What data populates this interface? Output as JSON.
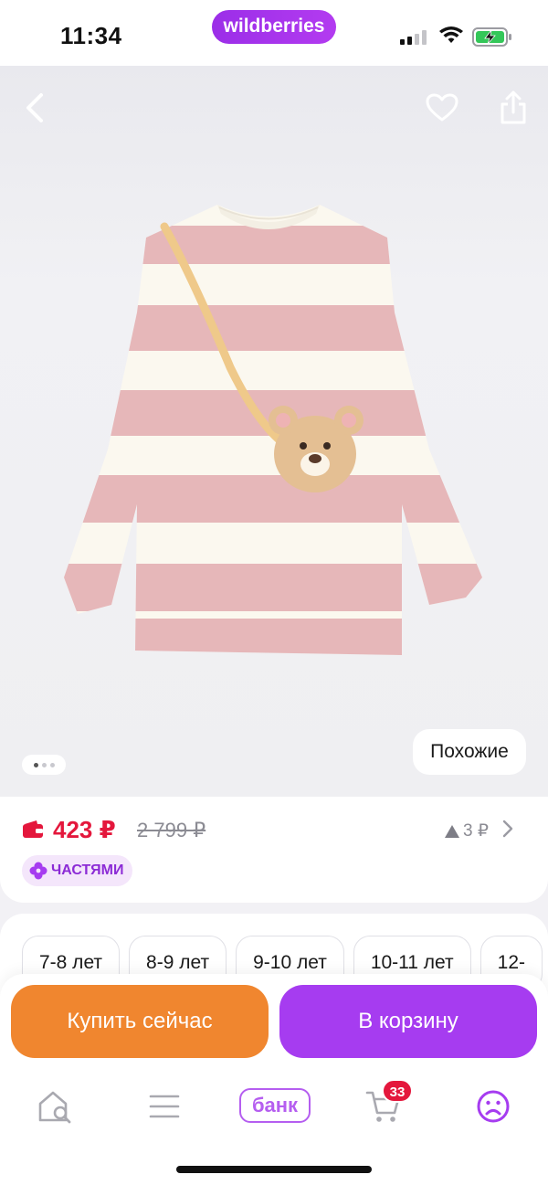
{
  "status_bar": {
    "time": "11:34",
    "brand": "wildberries"
  },
  "hero": {
    "back_icon": "chevron-left-icon",
    "favorite_icon": "heart-icon",
    "share_icon": "share-icon",
    "similar_label": "Похожие",
    "image_count": 3,
    "active_image": 1
  },
  "price": {
    "current": "423 ₽",
    "old": "2 799 ₽",
    "delta": "3 ₽",
    "installments_label": "ЧАСТЯМИ"
  },
  "sizes": [
    "7-8 лет",
    "8-9 лет",
    "9-10 лет",
    "10-11 лет",
    "12-"
  ],
  "actions": {
    "buy_now": "Купить сейчас",
    "add_to_cart": "В корзину"
  },
  "bottom_nav": {
    "bank_label": "банк",
    "cart_count": "33"
  },
  "colors": {
    "accent_purple": "#a63cf0",
    "orange": "#f0862f",
    "price_red": "#e4173c"
  }
}
